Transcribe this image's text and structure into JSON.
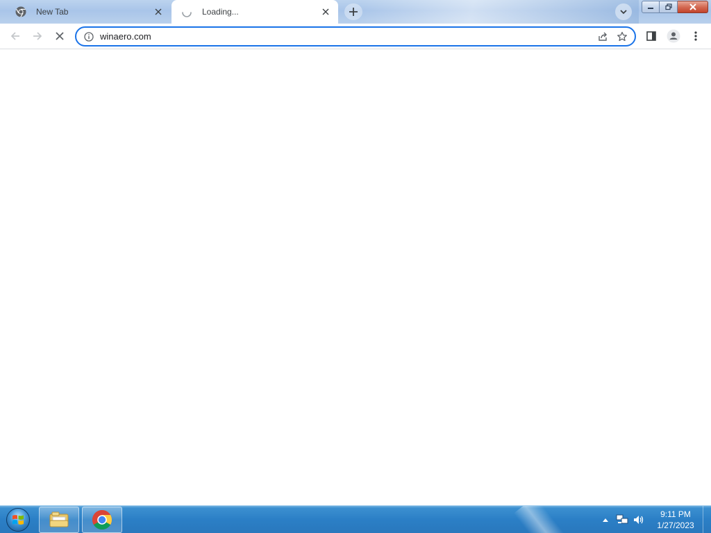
{
  "tabs": [
    {
      "title": "New Tab",
      "favicon": "chrome-icon",
      "active": false
    },
    {
      "title": "Loading...",
      "favicon": "loading-spinner-icon",
      "active": true
    }
  ],
  "new_tab_icon": "plus-icon",
  "tab_search_icon": "chevron-down-icon",
  "window_controls": [
    "minimize-icon",
    "maximize-icon",
    "close-icon"
  ],
  "toolbar": {
    "back_icon": "arrow-left-icon",
    "forward_icon": "arrow-right-icon",
    "stop_icon": "stop-loading-icon",
    "omnibox_value": "winaero.com",
    "site_info_icon": "info-icon",
    "share_icon": "share-icon",
    "bookmark_icon": "star-icon",
    "side_panel_icon": "side-panel-icon",
    "profile_icon": "profile-icon",
    "menu_icon": "kebab-menu-icon"
  },
  "taskbar": {
    "start_icon": "windows-start-icon",
    "apps": [
      "file-explorer-icon",
      "chrome-icon"
    ],
    "tray": {
      "show_hidden_icon": "triangle-up-icon",
      "network_icon": "network-icon",
      "volume_icon": "speaker-icon",
      "time": "9:11 PM",
      "date": "1/27/2023"
    }
  },
  "colors": {
    "accent": "#1a73e8",
    "tab_strip": "#b1cbeb",
    "taskbar": "#2b7fc6"
  }
}
